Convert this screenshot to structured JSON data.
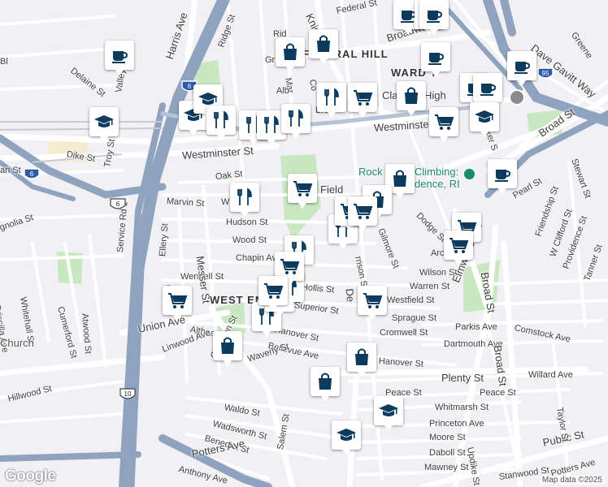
{
  "map": {
    "attribution": "Map data ©2025",
    "logo": "Google",
    "neighborhoods": [
      {
        "id": "federal-hill",
        "text": "FEDERAL HILL"
      },
      {
        "id": "ward",
        "text": "WARD T"
      },
      {
        "id": "west-end",
        "text": "WEST END"
      }
    ],
    "streets": [
      {
        "id": "harris-ave",
        "text": "Harris Ave"
      },
      {
        "id": "ridge-st",
        "text": "Ridge St"
      },
      {
        "id": "knight-st",
        "text": "Knight St"
      },
      {
        "id": "federal-st",
        "text": "Federal St"
      },
      {
        "id": "broadway",
        "text": "Broadway"
      },
      {
        "id": "dave-gavitt-way",
        "text": "Dave Gavitt Way"
      },
      {
        "id": "greene",
        "text": "Greene"
      },
      {
        "id": "delaine-st",
        "text": "Delaine St"
      },
      {
        "id": "valley-st",
        "text": "Valley St"
      },
      {
        "id": "dike-st",
        "text": "Dike St"
      },
      {
        "id": "troy-st",
        "text": "Troy St"
      },
      {
        "id": "westminster-st-1",
        "text": "Westminster St"
      },
      {
        "id": "westminster-st-2",
        "text": "Westminster St"
      },
      {
        "id": "oak-st",
        "text": "Oak St"
      },
      {
        "id": "marvin-st",
        "text": "Marvin St"
      },
      {
        "id": "hudson-st",
        "text": "Hudson St"
      },
      {
        "id": "wood-st",
        "text": "Wood St"
      },
      {
        "id": "chapin-av",
        "text": "Chapin Av"
      },
      {
        "id": "wendell-st",
        "text": "Wendell St"
      },
      {
        "id": "hollis-st",
        "text": "Hollis St"
      },
      {
        "id": "superior-st",
        "text": "Superior St"
      },
      {
        "id": "hanover-st-1",
        "text": "Hanover St"
      },
      {
        "id": "hanover-st-2",
        "text": "Hanover St"
      },
      {
        "id": "bellevue-ave",
        "text": "Bellevue Ave"
      },
      {
        "id": "waverly-st",
        "text": "Waverly St"
      },
      {
        "id": "althea",
        "text": "Althea"
      },
      {
        "id": "union-ave",
        "text": "Union Ave"
      },
      {
        "id": "linwood-ave",
        "text": "Linwood Ave"
      },
      {
        "id": "hillwood-st",
        "text": "Hillwood St"
      },
      {
        "id": "whitehall-st",
        "text": "Whitehall St"
      },
      {
        "id": "cumerford-st",
        "text": "Cumerford St"
      },
      {
        "id": "atwood-st",
        "text": "Atwood St"
      },
      {
        "id": "priscilla-ave",
        "text": "Priscilla Ave"
      },
      {
        "id": "magnolia-st",
        "text": "gnolia St"
      },
      {
        "id": "an-st",
        "text": "an St"
      },
      {
        "id": "church",
        "text": "Church"
      },
      {
        "id": "service-rd",
        "text": "Service Rd 1"
      },
      {
        "id": "ellery-st",
        "text": "Ellery St"
      },
      {
        "id": "messer-st",
        "text": "Messer St"
      },
      {
        "id": "cranston-st",
        "text": "Cranston St"
      },
      {
        "id": "waldo-st",
        "text": "Waldo St"
      },
      {
        "id": "wadsworth-st",
        "text": "Wadsworth St"
      },
      {
        "id": "benedict-st",
        "text": "Benedict St"
      },
      {
        "id": "potters-ave-1",
        "text": "Potters Ave"
      },
      {
        "id": "anthony-ave",
        "text": "Anthony Ave"
      },
      {
        "id": "salem-st",
        "text": "Salem St"
      },
      {
        "id": "dexter-st",
        "text": "De"
      },
      {
        "id": "harrison-st",
        "text": "rrison St"
      },
      {
        "id": "gilmore-st",
        "text": "Gilmore St"
      },
      {
        "id": "dodge-st",
        "text": "Dodge St"
      },
      {
        "id": "wilson-st",
        "text": "Wilson St"
      },
      {
        "id": "warren-st",
        "text": "Warren St"
      },
      {
        "id": "westfield-st",
        "text": "Westfield St"
      },
      {
        "id": "sprague-st",
        "text": "Sprague St"
      },
      {
        "id": "cromwell-st",
        "text": "Cromwell St"
      },
      {
        "id": "dartmouth-ave",
        "text": "Dartmouth Ave"
      },
      {
        "id": "parkis-ave",
        "text": "Parkis Ave"
      },
      {
        "id": "comstock-ave",
        "text": "Comstock Ave"
      },
      {
        "id": "plenty-st",
        "text": "Plenty St"
      },
      {
        "id": "willard-ave",
        "text": "Willard Ave"
      },
      {
        "id": "peace-st-1",
        "text": "Peace St"
      },
      {
        "id": "peace-st-2",
        "text": "Peace St"
      },
      {
        "id": "whitmarsh-st",
        "text": "Whitmarsh St"
      },
      {
        "id": "princeton-ave",
        "text": "Princeton Ave"
      },
      {
        "id": "moore-st",
        "text": "Moore St"
      },
      {
        "id": "daboll-st",
        "text": "Daboll St"
      },
      {
        "id": "mawney-st",
        "text": "Mawney St"
      },
      {
        "id": "stanwood-st",
        "text": "Stanwood St"
      },
      {
        "id": "potters-ave-2",
        "text": "Potters Ave"
      },
      {
        "id": "public-st",
        "text": "Public St"
      },
      {
        "id": "taylor-st",
        "text": "Taylor St"
      },
      {
        "id": "updike-st",
        "text": "Updike St"
      },
      {
        "id": "elmwood-ave",
        "text": "Elmwood Ave"
      },
      {
        "id": "broad-st-1",
        "text": "Broad St"
      },
      {
        "id": "broad-st-2",
        "text": "Broad St"
      },
      {
        "id": "broad-st-3",
        "text": "Broad St"
      },
      {
        "id": "stewart-st",
        "text": "Stewart St"
      },
      {
        "id": "pearl-st",
        "text": "Pearl St"
      },
      {
        "id": "friendship-st",
        "text": "Friendship St"
      },
      {
        "id": "w-clifford-st",
        "text": "W Clifford St"
      },
      {
        "id": "providence-st",
        "text": "Providence St"
      },
      {
        "id": "tanner-st",
        "text": "Tanner St"
      },
      {
        "id": "arc",
        "text": "Arc"
      },
      {
        "id": "decker",
        "text": "cker S"
      },
      {
        "id": "field",
        "text": "Field"
      },
      {
        "id": "high",
        "text": "High"
      },
      {
        "id": "classical",
        "text": "Classical"
      },
      {
        "id": "mar-st",
        "text": "Mar"
      },
      {
        "id": "gr",
        "text": "Gr"
      },
      {
        "id": "bro",
        "text": "Bro"
      },
      {
        "id": "wi",
        "text": "Wi"
      },
      {
        "id": "ro",
        "text": "Ro"
      },
      {
        "id": "alb",
        "text": "Alb"
      },
      {
        "id": "co",
        "text": "Co"
      },
      {
        "id": "rid",
        "text": "Rid"
      },
      {
        "id": "bl",
        "text": "Bl"
      }
    ],
    "poi_label": {
      "line1": "Rock",
      "line2": "Climbing:",
      "line3": "dence, RI"
    },
    "route_shields": [
      {
        "id": "i6-a",
        "text": "6"
      },
      {
        "id": "i6-b",
        "text": "6"
      },
      {
        "id": "us6",
        "text": "6"
      },
      {
        "id": "i10",
        "text": "10"
      },
      {
        "id": "i95",
        "text": "95"
      }
    ]
  },
  "markers": [
    {
      "type": "cafe"
    },
    {
      "type": "cafe"
    },
    {
      "type": "cafe"
    },
    {
      "type": "cafe"
    },
    {
      "type": "cafe"
    },
    {
      "type": "cafe"
    },
    {
      "type": "cafe"
    },
    {
      "type": "cafe"
    },
    {
      "type": "cafe"
    },
    {
      "type": "shopping"
    },
    {
      "type": "shopping"
    },
    {
      "type": "shopping"
    },
    {
      "type": "shopping"
    },
    {
      "type": "shopping"
    },
    {
      "type": "shopping"
    },
    {
      "type": "shopping"
    },
    {
      "type": "shopping"
    },
    {
      "type": "school"
    },
    {
      "type": "school"
    },
    {
      "type": "school"
    },
    {
      "type": "school"
    },
    {
      "type": "school"
    },
    {
      "type": "school"
    },
    {
      "type": "restaurant"
    },
    {
      "type": "restaurant"
    },
    {
      "type": "restaurant"
    },
    {
      "type": "restaurant"
    },
    {
      "type": "restaurant"
    },
    {
      "type": "restaurant"
    },
    {
      "type": "restaurant"
    },
    {
      "type": "restaurant"
    },
    {
      "type": "restaurant"
    },
    {
      "type": "restaurant"
    },
    {
      "type": "restaurant"
    },
    {
      "type": "grocery"
    },
    {
      "type": "grocery"
    },
    {
      "type": "grocery"
    },
    {
      "type": "grocery"
    },
    {
      "type": "grocery"
    },
    {
      "type": "grocery"
    },
    {
      "type": "grocery"
    },
    {
      "type": "grocery"
    },
    {
      "type": "grocery"
    },
    {
      "type": "grocery"
    },
    {
      "type": "grocery"
    }
  ],
  "colors": {
    "pin_icon": "#0d3b5e",
    "highway": "#8fa3bf",
    "park": "#c9e8c2",
    "road": "#ffffff",
    "land": "#f1f0f4"
  }
}
